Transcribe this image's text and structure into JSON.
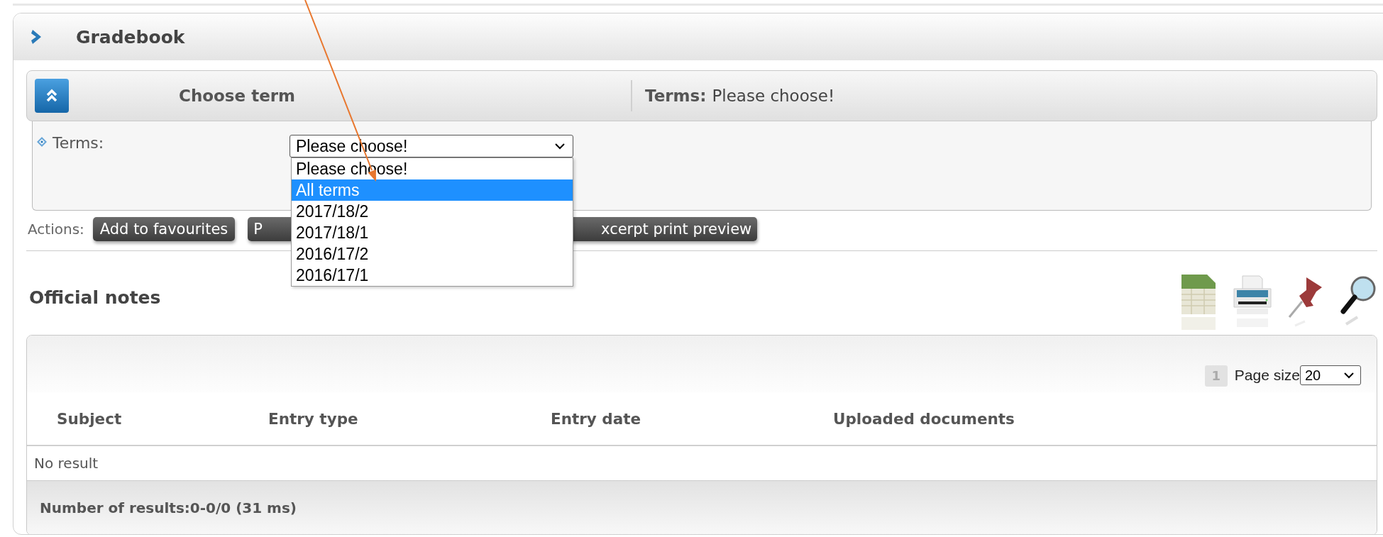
{
  "panel": {
    "title": "Gradebook"
  },
  "filter": {
    "title": "Choose term",
    "summary_label": "Terms:",
    "summary_value": "Please choose!",
    "field": {
      "label": "Terms:",
      "value": "Please choose!",
      "expanded": true,
      "options": [
        {
          "label": "Please choose!",
          "highlighted": false
        },
        {
          "label": "All terms",
          "highlighted": true
        },
        {
          "label": "2017/18/2",
          "highlighted": false
        },
        {
          "label": "2017/18/1",
          "highlighted": false
        },
        {
          "label": "2016/17/2",
          "highlighted": false
        },
        {
          "label": "2016/17/1",
          "highlighted": false
        }
      ]
    }
  },
  "actions": {
    "label": "Actions:",
    "buttons": [
      "Add to favourites",
      "P",
      "xcerpt print preview"
    ]
  },
  "section": {
    "title": "Official notes"
  },
  "grid": {
    "page": "1",
    "page_size_label": "Page size",
    "page_size": "20",
    "columns": [
      "Subject",
      "Entry type",
      "Entry date",
      "Uploaded documents"
    ],
    "empty_text": "No result",
    "footer": "Number of results:0-0/0 (31 ms)"
  }
}
